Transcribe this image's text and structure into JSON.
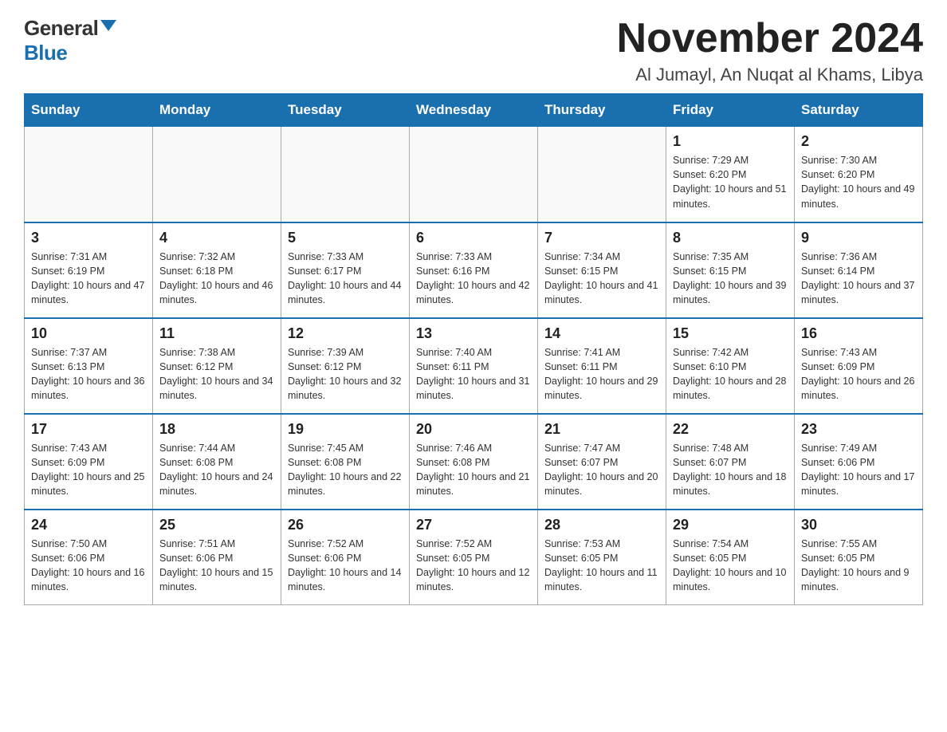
{
  "header": {
    "logo_general": "General",
    "logo_blue": "Blue",
    "month_title": "November 2024",
    "location": "Al Jumayl, An Nuqat al Khams, Libya"
  },
  "weekdays": [
    "Sunday",
    "Monday",
    "Tuesday",
    "Wednesday",
    "Thursday",
    "Friday",
    "Saturday"
  ],
  "weeks": [
    [
      {
        "day": "",
        "sunrise": "",
        "sunset": "",
        "daylight": ""
      },
      {
        "day": "",
        "sunrise": "",
        "sunset": "",
        "daylight": ""
      },
      {
        "day": "",
        "sunrise": "",
        "sunset": "",
        "daylight": ""
      },
      {
        "day": "",
        "sunrise": "",
        "sunset": "",
        "daylight": ""
      },
      {
        "day": "",
        "sunrise": "",
        "sunset": "",
        "daylight": ""
      },
      {
        "day": "1",
        "sunrise": "Sunrise: 7:29 AM",
        "sunset": "Sunset: 6:20 PM",
        "daylight": "Daylight: 10 hours and 51 minutes."
      },
      {
        "day": "2",
        "sunrise": "Sunrise: 7:30 AM",
        "sunset": "Sunset: 6:20 PM",
        "daylight": "Daylight: 10 hours and 49 minutes."
      }
    ],
    [
      {
        "day": "3",
        "sunrise": "Sunrise: 7:31 AM",
        "sunset": "Sunset: 6:19 PM",
        "daylight": "Daylight: 10 hours and 47 minutes."
      },
      {
        "day": "4",
        "sunrise": "Sunrise: 7:32 AM",
        "sunset": "Sunset: 6:18 PM",
        "daylight": "Daylight: 10 hours and 46 minutes."
      },
      {
        "day": "5",
        "sunrise": "Sunrise: 7:33 AM",
        "sunset": "Sunset: 6:17 PM",
        "daylight": "Daylight: 10 hours and 44 minutes."
      },
      {
        "day": "6",
        "sunrise": "Sunrise: 7:33 AM",
        "sunset": "Sunset: 6:16 PM",
        "daylight": "Daylight: 10 hours and 42 minutes."
      },
      {
        "day": "7",
        "sunrise": "Sunrise: 7:34 AM",
        "sunset": "Sunset: 6:15 PM",
        "daylight": "Daylight: 10 hours and 41 minutes."
      },
      {
        "day": "8",
        "sunrise": "Sunrise: 7:35 AM",
        "sunset": "Sunset: 6:15 PM",
        "daylight": "Daylight: 10 hours and 39 minutes."
      },
      {
        "day": "9",
        "sunrise": "Sunrise: 7:36 AM",
        "sunset": "Sunset: 6:14 PM",
        "daylight": "Daylight: 10 hours and 37 minutes."
      }
    ],
    [
      {
        "day": "10",
        "sunrise": "Sunrise: 7:37 AM",
        "sunset": "Sunset: 6:13 PM",
        "daylight": "Daylight: 10 hours and 36 minutes."
      },
      {
        "day": "11",
        "sunrise": "Sunrise: 7:38 AM",
        "sunset": "Sunset: 6:12 PM",
        "daylight": "Daylight: 10 hours and 34 minutes."
      },
      {
        "day": "12",
        "sunrise": "Sunrise: 7:39 AM",
        "sunset": "Sunset: 6:12 PM",
        "daylight": "Daylight: 10 hours and 32 minutes."
      },
      {
        "day": "13",
        "sunrise": "Sunrise: 7:40 AM",
        "sunset": "Sunset: 6:11 PM",
        "daylight": "Daylight: 10 hours and 31 minutes."
      },
      {
        "day": "14",
        "sunrise": "Sunrise: 7:41 AM",
        "sunset": "Sunset: 6:11 PM",
        "daylight": "Daylight: 10 hours and 29 minutes."
      },
      {
        "day": "15",
        "sunrise": "Sunrise: 7:42 AM",
        "sunset": "Sunset: 6:10 PM",
        "daylight": "Daylight: 10 hours and 28 minutes."
      },
      {
        "day": "16",
        "sunrise": "Sunrise: 7:43 AM",
        "sunset": "Sunset: 6:09 PM",
        "daylight": "Daylight: 10 hours and 26 minutes."
      }
    ],
    [
      {
        "day": "17",
        "sunrise": "Sunrise: 7:43 AM",
        "sunset": "Sunset: 6:09 PM",
        "daylight": "Daylight: 10 hours and 25 minutes."
      },
      {
        "day": "18",
        "sunrise": "Sunrise: 7:44 AM",
        "sunset": "Sunset: 6:08 PM",
        "daylight": "Daylight: 10 hours and 24 minutes."
      },
      {
        "day": "19",
        "sunrise": "Sunrise: 7:45 AM",
        "sunset": "Sunset: 6:08 PM",
        "daylight": "Daylight: 10 hours and 22 minutes."
      },
      {
        "day": "20",
        "sunrise": "Sunrise: 7:46 AM",
        "sunset": "Sunset: 6:08 PM",
        "daylight": "Daylight: 10 hours and 21 minutes."
      },
      {
        "day": "21",
        "sunrise": "Sunrise: 7:47 AM",
        "sunset": "Sunset: 6:07 PM",
        "daylight": "Daylight: 10 hours and 20 minutes."
      },
      {
        "day": "22",
        "sunrise": "Sunrise: 7:48 AM",
        "sunset": "Sunset: 6:07 PM",
        "daylight": "Daylight: 10 hours and 18 minutes."
      },
      {
        "day": "23",
        "sunrise": "Sunrise: 7:49 AM",
        "sunset": "Sunset: 6:06 PM",
        "daylight": "Daylight: 10 hours and 17 minutes."
      }
    ],
    [
      {
        "day": "24",
        "sunrise": "Sunrise: 7:50 AM",
        "sunset": "Sunset: 6:06 PM",
        "daylight": "Daylight: 10 hours and 16 minutes."
      },
      {
        "day": "25",
        "sunrise": "Sunrise: 7:51 AM",
        "sunset": "Sunset: 6:06 PM",
        "daylight": "Daylight: 10 hours and 15 minutes."
      },
      {
        "day": "26",
        "sunrise": "Sunrise: 7:52 AM",
        "sunset": "Sunset: 6:06 PM",
        "daylight": "Daylight: 10 hours and 14 minutes."
      },
      {
        "day": "27",
        "sunrise": "Sunrise: 7:52 AM",
        "sunset": "Sunset: 6:05 PM",
        "daylight": "Daylight: 10 hours and 12 minutes."
      },
      {
        "day": "28",
        "sunrise": "Sunrise: 7:53 AM",
        "sunset": "Sunset: 6:05 PM",
        "daylight": "Daylight: 10 hours and 11 minutes."
      },
      {
        "day": "29",
        "sunrise": "Sunrise: 7:54 AM",
        "sunset": "Sunset: 6:05 PM",
        "daylight": "Daylight: 10 hours and 10 minutes."
      },
      {
        "day": "30",
        "sunrise": "Sunrise: 7:55 AM",
        "sunset": "Sunset: 6:05 PM",
        "daylight": "Daylight: 10 hours and 9 minutes."
      }
    ]
  ]
}
